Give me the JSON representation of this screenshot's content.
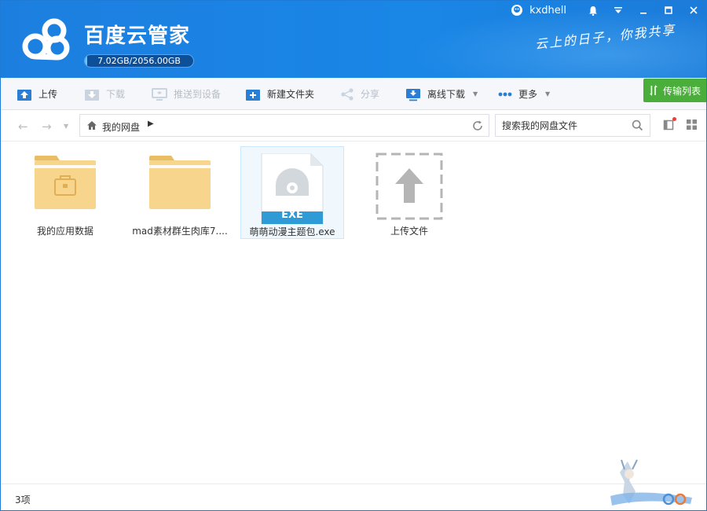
{
  "app": {
    "title": "百度云管家",
    "quota_text": "7.02GB/2056.00GB",
    "quota_fraction": 0.0034,
    "slogan": "云上的日子，你我共享"
  },
  "user": {
    "name": "kxdhell"
  },
  "toolbar": {
    "upload": "上传",
    "download": "下载",
    "push_device": "推送到设备",
    "new_folder": "新建文件夹",
    "share": "分享",
    "offline_download": "离线下载",
    "more": "更多",
    "transfer_list": "传输列表"
  },
  "nav": {
    "path_root": "我的网盘",
    "search_placeholder": "搜索我的网盘文件"
  },
  "files": [
    {
      "name": "我的应用数据",
      "type": "app-folder"
    },
    {
      "name": "mad素材群生肉库7....",
      "type": "folder"
    },
    {
      "name": "萌萌动漫主题包.exe",
      "type": "exe",
      "badge": "EXE"
    },
    {
      "name": "上传文件",
      "type": "upload-placeholder"
    }
  ],
  "status": {
    "count": "3项"
  },
  "colors": {
    "header_blue": "#1c7fe0",
    "transfer_green": "#4aae3a",
    "folder_yellow": "#f7d58c",
    "exe_badge": "#2e9bd6"
  }
}
